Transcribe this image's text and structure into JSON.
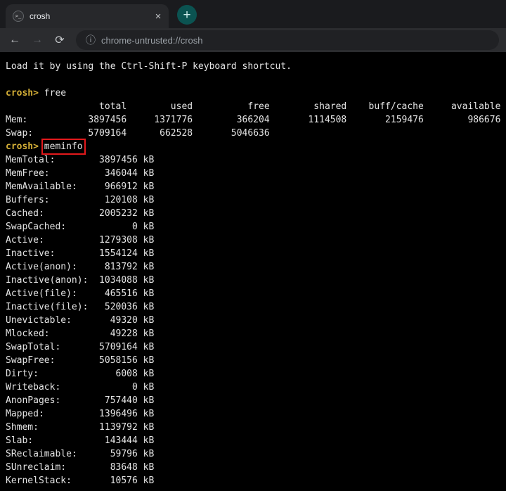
{
  "colors": {
    "prompt_gold": "#d4af37",
    "annotation_red": "#e3191c",
    "new_tab_teal": "#0b5351",
    "terminal_bg": "#000000",
    "terminal_text": "#e4e4e4"
  },
  "tabstrip": {
    "tab_title": "crosh",
    "favicon_glyph": ">_",
    "close_glyph": "×",
    "new_tab_glyph": "+"
  },
  "toolbar": {
    "back_glyph": "←",
    "forward_glyph": "→",
    "reload_glyph": "⟳",
    "info_glyph": "ⓘ",
    "url": "chrome-untrusted://crosh"
  },
  "terminal": {
    "prompt": "crosh>",
    "space": " ",
    "blank": "",
    "intro": "Load it by using the Ctrl-Shift-P keyboard shortcut.",
    "command_free": "free",
    "command_meminfo": "meminfo",
    "free_output": [
      "                 total        used          free        shared    buff/cache     available",
      "Mem:           3897456     1371776        366204       1114508       2159476        986676",
      "Swap:          5709164      662528       5046636"
    ],
    "meminfo_output": [
      "MemTotal:        3897456 kB",
      "MemFree:          346044 kB",
      "MemAvailable:     966912 kB",
      "Buffers:          120108 kB",
      "Cached:          2005232 kB",
      "SwapCached:            0 kB",
      "Active:          1279308 kB",
      "Inactive:        1554124 kB",
      "Active(anon):     813792 kB",
      "Inactive(anon):  1034088 kB",
      "Active(file):     465516 kB",
      "Inactive(file):   520036 kB",
      "Unevictable:       49320 kB",
      "Mlocked:           49228 kB",
      "SwapTotal:       5709164 kB",
      "SwapFree:        5058156 kB",
      "Dirty:              6008 kB",
      "Writeback:             0 kB",
      "AnonPages:        757440 kB",
      "Mapped:          1396496 kB",
      "Shmem:           1139792 kB",
      "Slab:             143444 kB",
      "SReclaimable:      59796 kB",
      "SUnreclaim:        83648 kB",
      "KernelStack:       10576 kB"
    ]
  }
}
